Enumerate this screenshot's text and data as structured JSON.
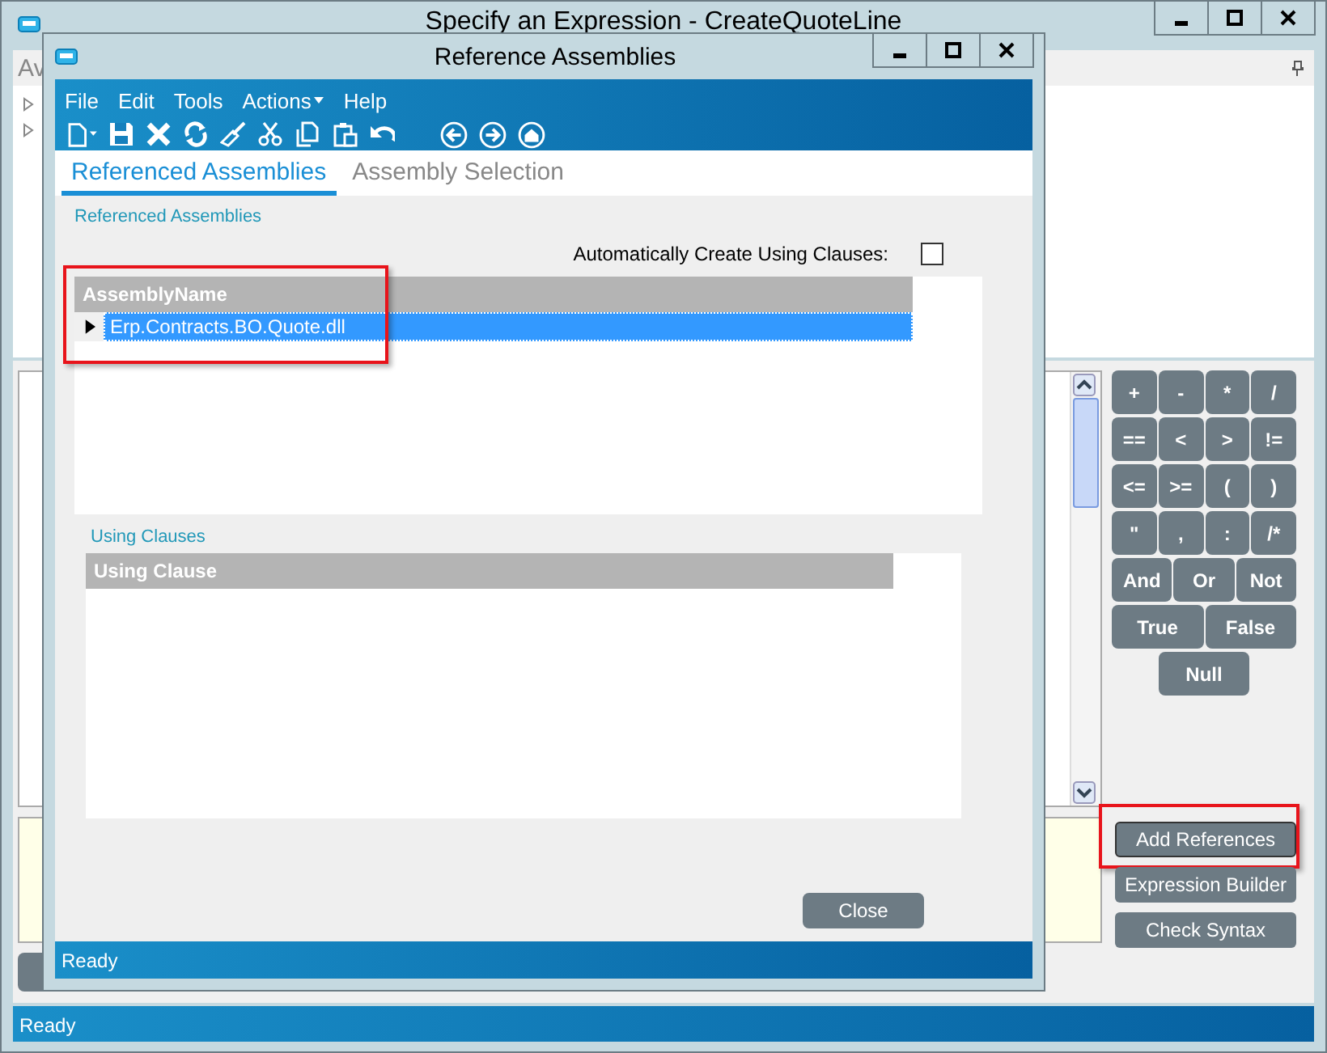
{
  "window": {
    "title": "Specify an Expression - CreateQuoteLine"
  },
  "left_panel": {
    "tab_label": "Av",
    "tree_items": [
      {
        "expanded": false
      },
      {
        "expanded": false
      }
    ]
  },
  "operators": [
    [
      "+",
      "-",
      "*",
      "/"
    ],
    [
      "==",
      "<",
      ">",
      "!="
    ],
    [
      "<=",
      ">=",
      "(",
      ")"
    ],
    [
      "\"",
      ",",
      ":",
      "/*"
    ],
    [
      "And",
      "Or",
      "Not"
    ],
    [
      "True",
      "False"
    ],
    [
      "Null"
    ]
  ],
  "side_buttons": [
    {
      "label": "Add References",
      "highlighted": true
    },
    {
      "label": "Expression Builder",
      "highlighted": false
    },
    {
      "label": "Check Syntax",
      "highlighted": false
    }
  ],
  "status_bar": "Ready",
  "dialog": {
    "title": "Reference Assemblies",
    "menu": [
      {
        "label": "File",
        "dropdown": false
      },
      {
        "label": "Edit",
        "dropdown": false
      },
      {
        "label": "Tools",
        "dropdown": false
      },
      {
        "label": "Actions",
        "dropdown": true
      },
      {
        "label": "Help",
        "dropdown": false
      }
    ],
    "tabs": [
      {
        "label": "Referenced Assemblies",
        "selected": true
      },
      {
        "label": "Assembly Selection",
        "selected": false
      }
    ],
    "section_title": "Referenced Assemblies",
    "auto_using": {
      "label": "Automatically Create Using Clauses:",
      "checked": false
    },
    "assemblies_grid": {
      "highlighted": true,
      "columns": [
        "AssemblyName"
      ],
      "rows": [
        {
          "cells": [
            "Erp.Contracts.BO.Quote.dll"
          ],
          "selected": true
        }
      ]
    },
    "using_section_title": "Using Clauses",
    "using_grid": {
      "columns": [
        "Using Clause"
      ]
    },
    "close_button": "Close",
    "status_bar": "Ready"
  }
}
